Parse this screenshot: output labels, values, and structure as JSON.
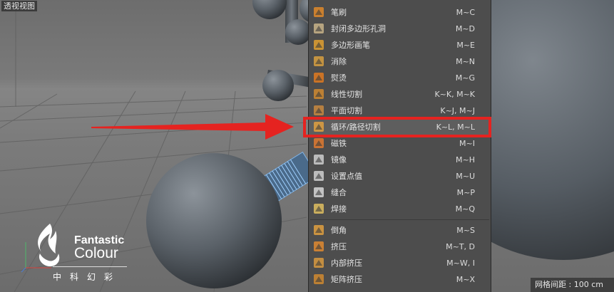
{
  "viewport": {
    "label": "透视视图",
    "grid_readout": "网格间距 : 100 cm"
  },
  "menu": {
    "items": [
      {
        "label": "笔刷",
        "shortcut": "M~C",
        "icon": "brush-icon"
      },
      {
        "label": "封闭多边形孔洞",
        "shortcut": "M~D",
        "icon": "close-polygon-hole-icon"
      },
      {
        "label": "多边形画笔",
        "shortcut": "M~E",
        "icon": "polygon-pen-icon"
      },
      {
        "label": "消除",
        "shortcut": "M~N",
        "icon": "dissolve-icon"
      },
      {
        "label": "熨烫",
        "shortcut": "M~G",
        "icon": "iron-icon"
      },
      {
        "label": "线性切割",
        "shortcut": "K~K, M~K",
        "icon": "line-cut-icon"
      },
      {
        "label": "平面切割",
        "shortcut": "K~J, M~J",
        "icon": "plane-cut-icon"
      },
      {
        "label": "循环/路径切割",
        "shortcut": "K~L, M~L",
        "icon": "loop-path-cut-icon",
        "highlighted": true
      },
      {
        "label": "磁铁",
        "shortcut": "M~I",
        "icon": "magnet-icon"
      },
      {
        "label": "镜像",
        "shortcut": "M~H",
        "icon": "mirror-icon"
      },
      {
        "label": "设置点值",
        "shortcut": "M~U",
        "icon": "set-point-value-icon"
      },
      {
        "label": "缝合",
        "shortcut": "M~P",
        "icon": "stitch-icon"
      },
      {
        "label": "焊接",
        "shortcut": "M~Q",
        "icon": "weld-icon"
      },
      {
        "label": "倒角",
        "shortcut": "M~S",
        "icon": "bevel-icon"
      },
      {
        "label": "挤压",
        "shortcut": "M~T, D",
        "icon": "extrude-icon"
      },
      {
        "label": "内部挤压",
        "shortcut": "M~W, I",
        "icon": "extrude-inner-icon"
      },
      {
        "label": "矩阵挤压",
        "shortcut": "M~X",
        "icon": "matrix-extrude-icon"
      }
    ]
  },
  "logo": {
    "line1": "Fantastic",
    "line2": "Colour",
    "chinese": "中科幻彩"
  },
  "colors": {
    "highlight_box": "#e52320",
    "arrow": "#e52320",
    "menu_bg": "#4d4d4d"
  }
}
